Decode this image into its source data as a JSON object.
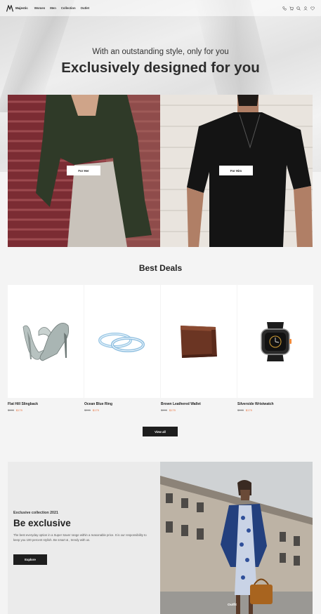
{
  "brand": {
    "name": "Majestic"
  },
  "nav": {
    "links": [
      "Women",
      "Men",
      "Collection",
      "Outlet"
    ],
    "icons": [
      "phone-icon",
      "cart-icon",
      "search-icon",
      "user-icon",
      "heart-icon"
    ]
  },
  "hero": {
    "subtitle": "With an outstanding style, only for you",
    "title": "Exclusively designed for you"
  },
  "categories": {
    "her_label": "For Her",
    "him_label": "For Him"
  },
  "deals": {
    "title": "Best Deals",
    "products": [
      {
        "name": "Flat Hill Slingback",
        "old_price": "$999",
        "new_price": "$179"
      },
      {
        "name": "Ocean Blue Ring",
        "old_price": "$999",
        "new_price": "$179"
      },
      {
        "name": "Brown Leathered Wallet",
        "old_price": "$999",
        "new_price": "$179"
      },
      {
        "name": "Silverside Wristwatch",
        "old_price": "$999",
        "new_price": "$179"
      }
    ],
    "view_all_label": "View all"
  },
  "exclusive": {
    "eyebrow": "Exclusive collection 2021",
    "title": "Be exclusive",
    "description": "The best everyday option in a Super Saver range within a reasonable price. It is our responsibility to keep you 100 percent stylish. Be smart & , trendy with us.",
    "button_label": "Explore",
    "image_caption": "Outfit"
  },
  "colors": {
    "accent_price": "#e86f3a",
    "dark_button": "#1e1e1e"
  }
}
